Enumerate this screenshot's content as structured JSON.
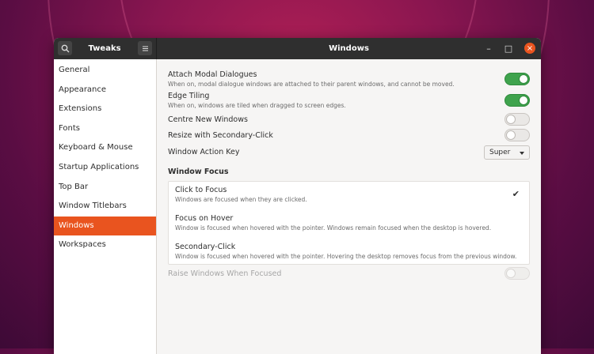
{
  "header": {
    "left_title": "Tweaks",
    "title": "Windows",
    "controls": {
      "minimize": "–",
      "maximize": "□",
      "close": "×"
    }
  },
  "sidebar": {
    "items": [
      {
        "label": "General"
      },
      {
        "label": "Appearance"
      },
      {
        "label": "Extensions"
      },
      {
        "label": "Fonts"
      },
      {
        "label": "Keyboard & Mouse"
      },
      {
        "label": "Startup Applications"
      },
      {
        "label": "Top Bar"
      },
      {
        "label": "Window Titlebars"
      },
      {
        "label": "Windows",
        "active": true
      },
      {
        "label": "Workspaces"
      }
    ]
  },
  "settings": {
    "attach_modal": {
      "title": "Attach Modal Dialogues",
      "desc": "When on, modal dialogue windows are attached to their parent windows, and cannot be moved.",
      "on": true
    },
    "edge_tiling": {
      "title": "Edge Tiling",
      "desc": "When on, windows are tiled when dragged to screen edges.",
      "on": true
    },
    "centre_new": {
      "title": "Centre New Windows",
      "on": false
    },
    "resize_secondary": {
      "title": "Resize with Secondary-Click",
      "on": false
    },
    "action_key": {
      "title": "Window Action Key",
      "value": "Super"
    },
    "focus_section": "Window Focus",
    "focus_options": [
      {
        "title": "Click to Focus",
        "desc": "Windows are focused when they are clicked.",
        "selected": true
      },
      {
        "title": "Focus on Hover",
        "desc": "Window is focused when hovered with the pointer. Windows remain focused when the desktop is hovered.",
        "selected": false
      },
      {
        "title": "Secondary-Click",
        "desc": "Window is focused when hovered with the pointer. Hovering the desktop removes focus from the previous window.",
        "selected": false
      }
    ],
    "raise_windows": {
      "title": "Raise Windows When Focused",
      "on": false,
      "disabled": true
    }
  },
  "colors": {
    "accent": "#e9541f",
    "switch_on": "#3fa34d",
    "titlebar": "#2f2f2f"
  },
  "icons": {
    "search": "search-icon",
    "menu": "hamburger-menu-icon",
    "check": "check-icon"
  }
}
